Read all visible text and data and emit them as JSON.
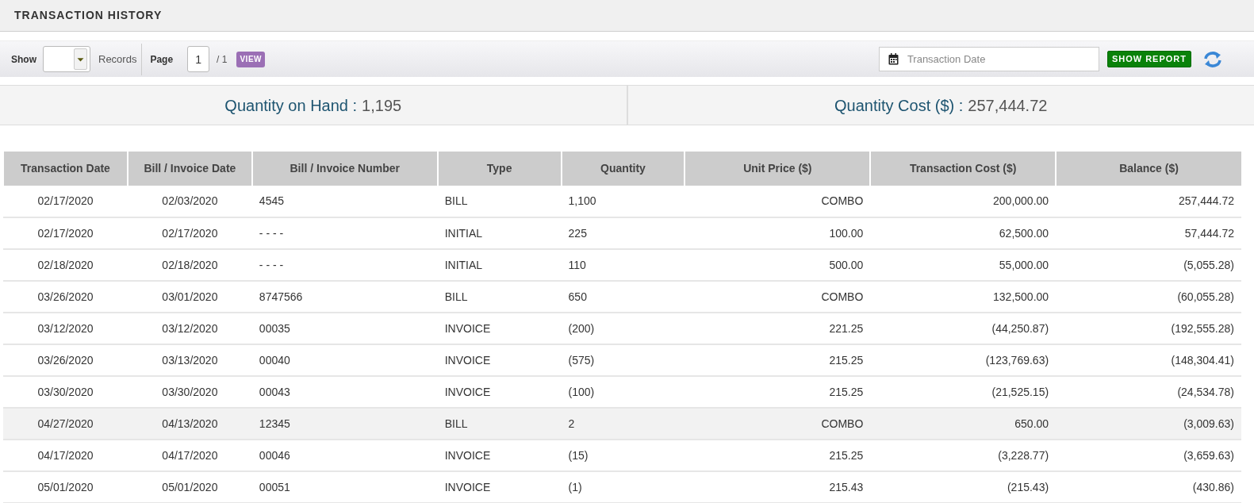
{
  "page_title": "TRANSACTION HISTORY",
  "toolbar": {
    "show_label": "Show",
    "records_label": "Records",
    "page_label": "Page",
    "page_value": "1",
    "page_total": "/ 1",
    "view_button": "VIEW",
    "date_field": {
      "placeholder": "Transaction Date"
    },
    "show_report_button": "SHOW REPORT"
  },
  "summary": [
    {
      "label": "Quantity on Hand :",
      "value": "1,195"
    },
    {
      "label": "Quantity Cost ($) :",
      "value": "257,444.72"
    }
  ],
  "table": {
    "columns": [
      "Transaction Date",
      "Bill / Invoice Date",
      "Bill / Invoice Number",
      "Type",
      "Quantity",
      "Unit Price ($)",
      "Transaction Cost ($)",
      "Balance ($)"
    ],
    "rows": [
      {
        "selected": false,
        "cells": [
          "02/17/2020",
          "02/03/2020",
          "4545",
          "BILL",
          "1,100",
          "COMBO",
          "200,000.00",
          "257,444.72"
        ]
      },
      {
        "selected": false,
        "cells": [
          "02/17/2020",
          "02/17/2020",
          "- - - -",
          "INITIAL",
          "225",
          "100.00",
          "62,500.00",
          "57,444.72"
        ]
      },
      {
        "selected": false,
        "cells": [
          "02/18/2020",
          "02/18/2020",
          "- - - -",
          "INITIAL",
          "110",
          "500.00",
          "55,000.00",
          "(5,055.28)"
        ]
      },
      {
        "selected": false,
        "cells": [
          "03/26/2020",
          "03/01/2020",
          "8747566",
          "BILL",
          "650",
          "COMBO",
          "132,500.00",
          "(60,055.28)"
        ]
      },
      {
        "selected": false,
        "cells": [
          "03/12/2020",
          "03/12/2020",
          "00035",
          "INVOICE",
          "(200)",
          "221.25",
          "(44,250.87)",
          "(192,555.28)"
        ]
      },
      {
        "selected": false,
        "cells": [
          "03/26/2020",
          "03/13/2020",
          "00040",
          "INVOICE",
          "(575)",
          "215.25",
          "(123,769.63)",
          "(148,304.41)"
        ]
      },
      {
        "selected": false,
        "cells": [
          "03/30/2020",
          "03/30/2020",
          "00043",
          "INVOICE",
          "(100)",
          "215.25",
          "(21,525.15)",
          "(24,534.78)"
        ]
      },
      {
        "selected": true,
        "cells": [
          "04/27/2020",
          "04/13/2020",
          "12345",
          "BILL",
          "2",
          "COMBO",
          "650.00",
          "(3,009.63)"
        ]
      },
      {
        "selected": false,
        "cells": [
          "04/17/2020",
          "04/17/2020",
          "00046",
          "INVOICE",
          "(15)",
          "215.25",
          "(3,228.77)",
          "(3,659.63)"
        ]
      },
      {
        "selected": false,
        "cells": [
          "05/01/2020",
          "05/01/2020",
          "00051",
          "INVOICE",
          "(1)",
          "215.43",
          "(215.43)",
          "(430.86)"
        ]
      }
    ]
  }
}
